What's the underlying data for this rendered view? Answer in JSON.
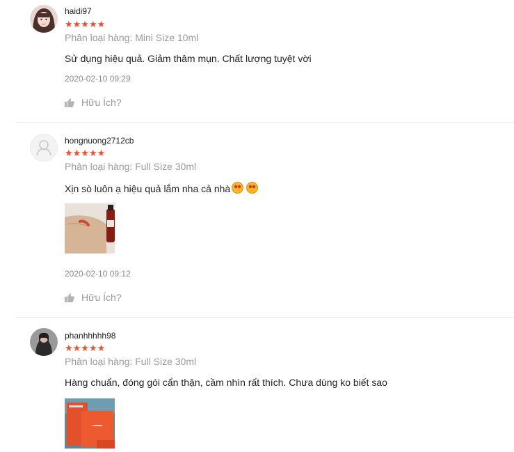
{
  "reviews": [
    {
      "username": "haidi97",
      "stars": "★★★★★",
      "variation": "Phân loại hàng: Mini Size 10ml",
      "content": "Sử dụng hiệu quả. Giảm thâm mụn. Chất lượng tuyệt vời",
      "time": "2020-02-10 09:29",
      "helpful": "Hữu Ích?"
    },
    {
      "username": "hongnuong2712cb",
      "stars": "★★★★★",
      "variation": "Phân loại hàng: Full Size 30ml",
      "content": "Xịn sò luôn ạ hiệu quả lắm nha cả nhà",
      "time": "2020-02-10 09:12",
      "helpful": "Hữu Ích?"
    },
    {
      "username": "phanhhhhh98",
      "stars": "★★★★★",
      "variation": "Phân loại hàng: Full Size 30ml",
      "content": "Hàng chuẩn, đóng gói cẩn thận, cầm nhìn rất thích. Chưa dùng ko biết sao"
    }
  ],
  "colors": {
    "star": "#ee4d2d",
    "muted": "#9a9a9a",
    "divider": "#e8e8e8"
  },
  "icons": [
    "thumbs-up-icon",
    "default-avatar-icon",
    "star-struck-emoji"
  ]
}
